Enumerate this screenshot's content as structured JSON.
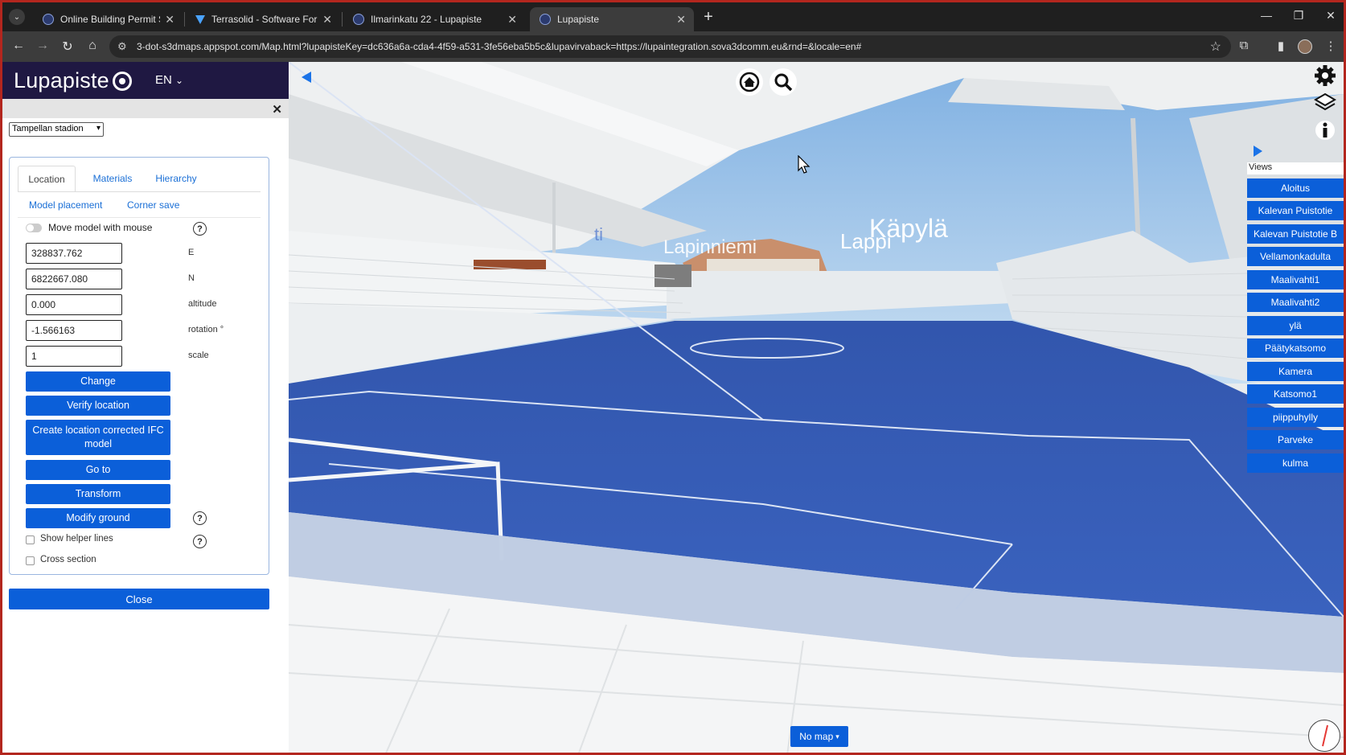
{
  "browser": {
    "tabs": [
      {
        "title": "Online Building Permit Softwar",
        "active": false
      },
      {
        "title": "Terrasolid - Software For Point C",
        "active": false
      },
      {
        "title": "Ilmarinkatu 22 - Lupapiste",
        "active": false
      },
      {
        "title": "Lupapiste",
        "active": true
      }
    ],
    "url": "3-dot-s3dmaps.appspot.com/Map.html?lupapisteKey=dc636a6a-cda4-4f59-a531-3fe56eba5b5c&lupavirvaback=https://lupaintegration.sova3dcomm.eu&rnd=&locale=en#",
    "icons": {
      "back": "back-arrow-icon",
      "forward": "forward-arrow-icon",
      "reload": "reload-icon",
      "home": "home-icon",
      "bookmark": "star-icon",
      "extensions": "puzzle-icon",
      "side_panel": "side-panel-icon",
      "menu": "kebab-menu-icon"
    }
  },
  "panel": {
    "logo_text": "Lupapiste",
    "language": "EN",
    "model_selector": "Tampellan stadion",
    "tabs": {
      "location": "Location",
      "materials": "Materials",
      "hierarchy": "Hierarchy"
    },
    "subtabs": {
      "model_placement": "Model placement",
      "corner_save": "Corner save"
    },
    "move_model_label": "Move model with mouse",
    "help_symbol": "?",
    "fields": {
      "easting": {
        "value": "328837.762",
        "label": "E"
      },
      "northing": {
        "value": "6822667.080",
        "label": "N"
      },
      "altitude": {
        "value": "0.000",
        "label": "altitude"
      },
      "rotation": {
        "value": "-1.566163",
        "label": "rotation °"
      },
      "scale": {
        "value": "1",
        "label": "scale"
      }
    },
    "buttons": {
      "change": "Change",
      "verify": "Verify location",
      "create_ifc": "Create location corrected IFC model",
      "go_to": "Go to",
      "transform": "Transform",
      "modify_ground": "Modify ground"
    },
    "checkboxes": {
      "helper_lines": "Show helper lines",
      "cross_section": "Cross section"
    },
    "close": "Close"
  },
  "viewer": {
    "place_labels": {
      "kapyla": "Käpylä",
      "lappi": "Lappi",
      "lapinniemi_partial": "Lapinniemi",
      "left_partial": "ti"
    },
    "views_label": "Views",
    "views": [
      "Aloitus",
      "Kalevan Puistotie",
      "Kalevan Puistotie B",
      "Vellamonkadulta",
      "Maalivahti1",
      "Maalivahti2",
      "ylä",
      "Päätykatsomo",
      "Kamera",
      "Katsomo1",
      "piippuhylly",
      "Parveke",
      "kulma"
    ],
    "map_selector": "No map",
    "colors": {
      "accent": "#0b5fd9",
      "field": "#3a5db3",
      "sky": "#9cc2e6",
      "header": "#1f1842"
    }
  }
}
